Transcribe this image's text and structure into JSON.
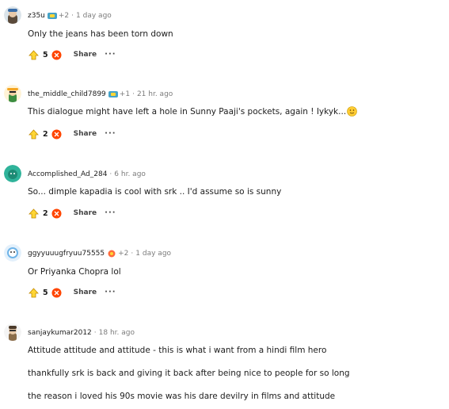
{
  "comments": [
    {
      "username": "z35u",
      "award_count": "+2",
      "time": "1 day ago",
      "body": "Only the jeans has been torn down",
      "score": "5",
      "share_label": "Share"
    },
    {
      "username": "the_middle_child7899",
      "award_count": "+1",
      "time": "21 hr. ago",
      "body": "This dialogue might have left a hole in Sunny Paaji's pockets, again ! Iykyk...",
      "score": "2",
      "share_label": "Share"
    },
    {
      "username": "Accomplished_Ad_284",
      "time": "6 hr. ago",
      "body": "So... dimple kapadia is cool with srk .. I'd assume so is sunny",
      "score": "2",
      "share_label": "Share"
    },
    {
      "username": "ggyyuuugfryuu75555",
      "award_count": "+2",
      "time": "1 day ago",
      "body": "Or Priyanka Chopra lol",
      "score": "5",
      "share_label": "Share"
    },
    {
      "username": "sanjaykumar2012",
      "time": "18 hr. ago",
      "body_lines": [
        "Attitude attitude and attitude - this is what i want from a hindi film hero",
        "thankfully srk is back and giving it back after being nice to people for so long",
        "the reason i loved his 90s movie was his dare devilry in films and attitude"
      ]
    }
  ],
  "separator": "·",
  "colors": {
    "upvote": "#ffb000",
    "downvote": "#ff4500",
    "meta_text": "#7c7c7c",
    "divider": "#edeff1"
  }
}
